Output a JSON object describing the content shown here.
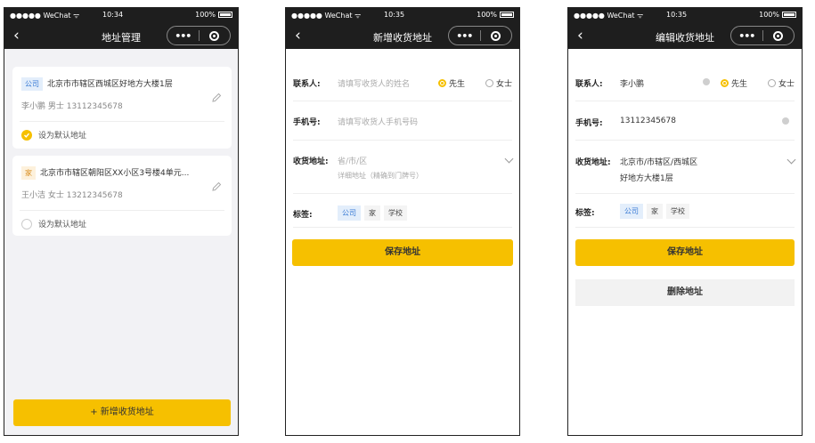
{
  "status": {
    "carrier": "●●●●● WeChat ᯤ",
    "battery": "100%",
    "times": [
      "10:34",
      "10:35",
      "10:35"
    ]
  },
  "screen1": {
    "title": "地址管理",
    "addresses": [
      {
        "tag": "公司",
        "address": "北京市市辖区西城区好地方大楼1层",
        "contact": "李小鹏 男士 13112345678",
        "default_label": "设为默认地址",
        "is_default": true
      },
      {
        "tag": "家",
        "address": "北京市市辖区朝阳区XX小区3号楼4单元...",
        "contact": "王小洁 女士 13212345678",
        "default_label": "设为默认地址",
        "is_default": false
      }
    ],
    "add_button": "+ 新增收货地址"
  },
  "screen2": {
    "title": "新增收货地址",
    "contact_label": "联系人:",
    "contact_placeholder": "请填写收货人的姓名",
    "gender_male": "先生",
    "gender_female": "女士",
    "phone_label": "手机号:",
    "phone_placeholder": "请填写收货人手机号码",
    "address_label": "收货地址:",
    "region_placeholder": "省/市/区",
    "detail_placeholder": "详细地址（精确到门牌号）",
    "tag_label": "标签:",
    "tags": [
      "公司",
      "家",
      "学校"
    ],
    "save_button": "保存地址"
  },
  "screen3": {
    "title": "编辑收货地址",
    "contact_label": "联系人:",
    "contact_value": "李小鹏",
    "gender_male": "先生",
    "gender_female": "女士",
    "phone_label": "手机号:",
    "phone_value": "13112345678",
    "address_label": "收货地址:",
    "region_value": "北京市/市辖区/西城区",
    "detail_value": "好地方大楼1层",
    "tag_label": "标签:",
    "tags": [
      "公司",
      "家",
      "学校"
    ],
    "save_button": "保存地址",
    "delete_button": "删除地址"
  },
  "colors": {
    "accent": "#f6c000",
    "nav": "#1e1e1e",
    "tag_blue": "#3a7bd5"
  }
}
